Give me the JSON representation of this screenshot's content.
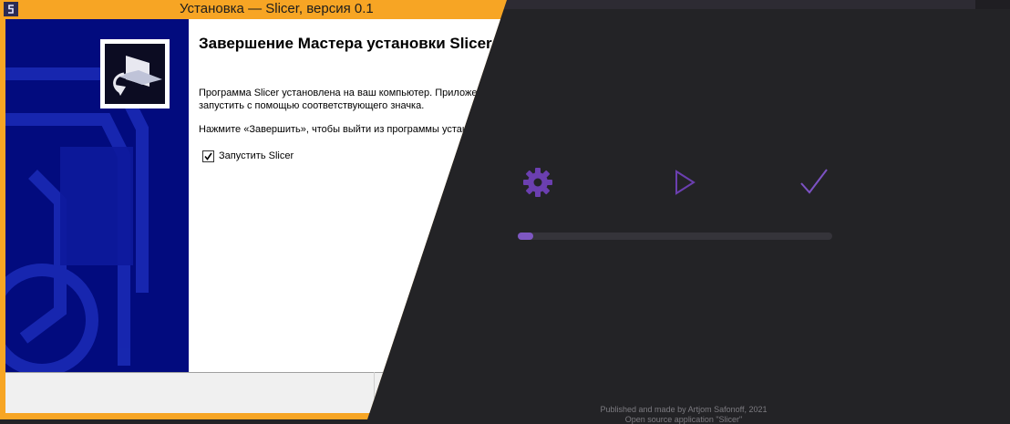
{
  "installer": {
    "window_title": "Установка — Slicer, версия 0.1",
    "heading": "Завершение Мастера установки Slicer",
    "line1": "Программа Slicer установлена на ваш компьютер. Приложение можно",
    "line2": "запустить с помощью соответствующего значка.",
    "line3": "Нажмите «Завершить», чтобы выйти из программы установки.",
    "checkbox_label": "Запустить Slicer",
    "checkbox_checked": true
  },
  "app": {
    "steps": [
      {
        "icon": "gear-icon"
      },
      {
        "icon": "play-icon"
      },
      {
        "icon": "checkmark-icon"
      }
    ],
    "progress_fraction": 0.05,
    "footer_line1": "Published and made by Artjom Safonoff, 2021",
    "footer_line2": "Open source application \"Slicer\"",
    "accent_color": "#7e57c2"
  }
}
